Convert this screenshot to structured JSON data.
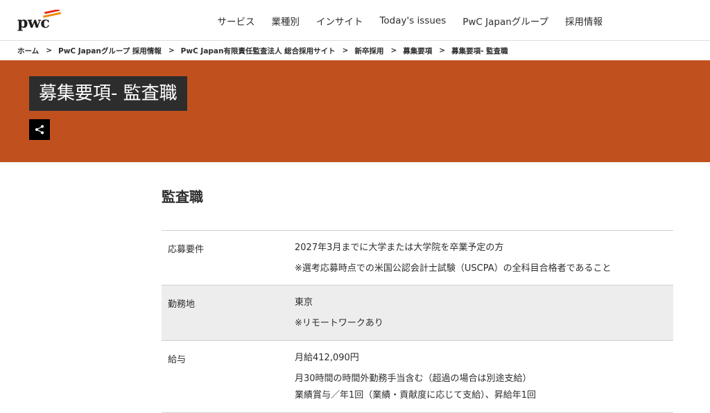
{
  "header": {
    "logo_text": "pwc",
    "logo_mark": "pwc-logo-mark",
    "nav": [
      "サービス",
      "業種別",
      "インサイト",
      "Today's issues",
      "PwC Japanグループ",
      "採用情報"
    ]
  },
  "breadcrumb": {
    "items": [
      "ホーム",
      "PwC Japanグループ 採用情報",
      "PwC Japan有限責任監査法人 総合採用サイト",
      "新卒採用",
      "募集要項",
      "募集要項- 監査職"
    ],
    "separator": ">"
  },
  "hero": {
    "title": "募集要項- 監査職",
    "share_icon": "share-icon"
  },
  "section": {
    "title": "監査職"
  },
  "table": {
    "rows": [
      {
        "label": "応募要件",
        "values": [
          "2027年3月までに大学または大学院を卒業予定の方",
          "※選考応募時点での米国公認会計士試験（USCPA）の全科目合格者であること"
        ]
      },
      {
        "label": "勤務地",
        "values": [
          "東京",
          "※リモートワークあり"
        ]
      },
      {
        "label": "給与",
        "values": [
          "月給412,090円",
          "月30時間の時間外勤務手当含む（超過の場合は別途支給）",
          "業績賞与／年1回（業績・貢献度に応じて支給）、昇給年1回"
        ]
      }
    ]
  },
  "colors": {
    "hero_background": "#c0511f",
    "title_background": "#2d2d2d",
    "logo_orange": "#e0301e",
    "logo_amber": "#eb8c00",
    "row_shade": "#ededed"
  }
}
